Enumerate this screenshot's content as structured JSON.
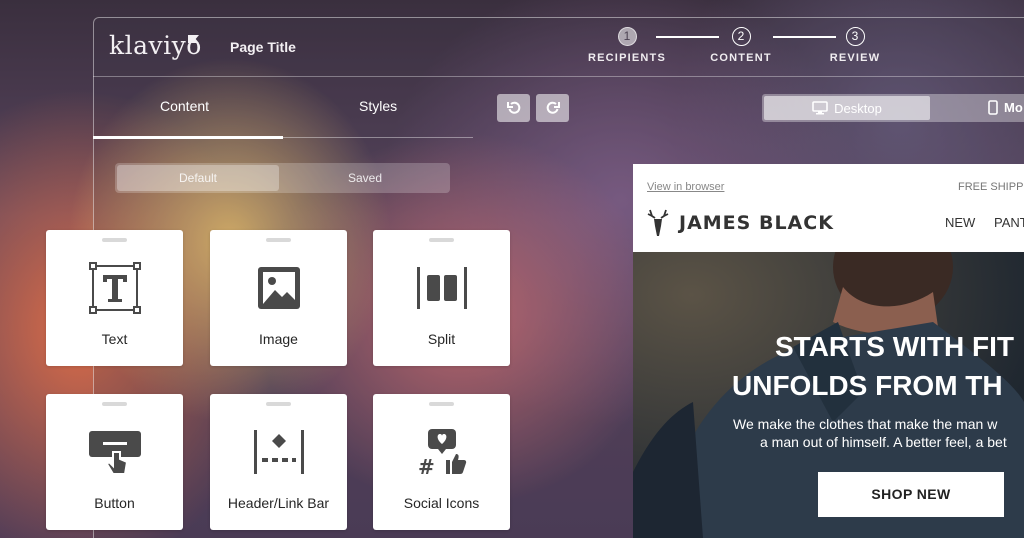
{
  "app": {
    "logo_text": "klaviyo",
    "page_title": "Page Title"
  },
  "steps": [
    {
      "number": "1",
      "label": "RECIPIENTS",
      "active": true
    },
    {
      "number": "2",
      "label": "CONTENT",
      "active": false
    },
    {
      "number": "3",
      "label": "REVIEW",
      "active": false
    }
  ],
  "tabs": {
    "content_label": "Content",
    "styles_label": "Styles",
    "active": "Content"
  },
  "toolbar": {
    "undo_icon": "undo-icon",
    "redo_icon": "redo-icon"
  },
  "view_toggle": {
    "desktop_label": "Desktop",
    "mobile_label": "Mo",
    "selected": "Desktop"
  },
  "library_toggle": {
    "default_label": "Default",
    "saved_label": "Saved",
    "selected": "Default"
  },
  "blocks": [
    {
      "label": "Text",
      "icon": "text-block-icon"
    },
    {
      "label": "Image",
      "icon": "image-block-icon"
    },
    {
      "label": "Split",
      "icon": "split-block-icon"
    },
    {
      "label": "Button",
      "icon": "button-block-icon"
    },
    {
      "label": "Header/Link Bar",
      "icon": "header-link-bar-icon"
    },
    {
      "label": "Social Icons",
      "icon": "social-icons-icon"
    }
  ],
  "email_preview": {
    "view_in_browser": "View in browser",
    "free_shipping": "FREE SHIPP",
    "brand_name": "JAMES BLACK",
    "nav": [
      "NEW",
      "PANT"
    ],
    "headline_line1": "STARTS WITH FIT",
    "headline_line2": "UNFOLDS FROM TH",
    "body_line1": "We make the clothes that make the man w",
    "body_line2": "a man out of himself. A better feel, a bet",
    "cta_label": "SHOP NEW"
  },
  "colors": {
    "card_background": "#ffffff",
    "card_text": "#262626",
    "icon_gray": "#4a4a4a",
    "hero_background": "#2c3541"
  }
}
